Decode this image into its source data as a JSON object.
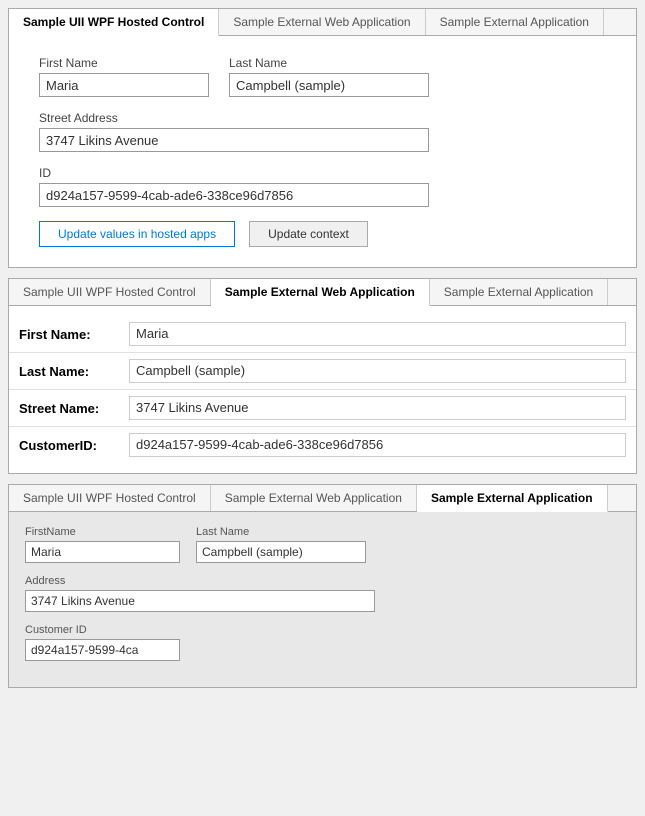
{
  "panel1": {
    "tabs": [
      {
        "label": "Sample UII WPF Hosted Control",
        "active": true
      },
      {
        "label": "Sample External Web Application",
        "active": false
      },
      {
        "label": "Sample External Application",
        "active": false
      }
    ],
    "fields": {
      "first_name_label": "First Name",
      "first_name_value": "Maria",
      "last_name_label": "Last Name",
      "last_name_value": "Campbell (sample)",
      "street_label": "Street Address",
      "street_value": "3747 Likins Avenue",
      "id_label": "ID",
      "id_value": "d924a157-9599-4cab-ade6-338ce96d7856"
    },
    "buttons": {
      "update_hosted": "Update values in hosted apps",
      "update_context": "Update context"
    }
  },
  "panel2": {
    "tabs": [
      {
        "label": "Sample UII WPF Hosted Control",
        "active": false
      },
      {
        "label": "Sample External Web Application",
        "active": true
      },
      {
        "label": "Sample External Application",
        "active": false
      }
    ],
    "rows": [
      {
        "label": "First Name:",
        "value": "Maria"
      },
      {
        "label": "Last Name:",
        "value": "Campbell (sample)"
      },
      {
        "label": "Street Name:",
        "value": "3747 Likins Avenue"
      },
      {
        "label": "CustomerID:",
        "value": "d924a157-9599-4cab-ade6-338ce96d7856"
      }
    ]
  },
  "panel3": {
    "tabs": [
      {
        "label": "Sample UII WPF Hosted Control",
        "active": false
      },
      {
        "label": "Sample External Web Application",
        "active": false
      },
      {
        "label": "Sample External Application",
        "active": true
      }
    ],
    "fields": {
      "first_name_label": "FirstName",
      "first_name_value": "Maria",
      "last_name_label": "Last Name",
      "last_name_value": "Campbell (sample)",
      "address_label": "Address",
      "address_value": "3747 Likins Avenue",
      "customer_id_label": "Customer ID",
      "customer_id_value": "d924a157-9599-4ca"
    }
  }
}
